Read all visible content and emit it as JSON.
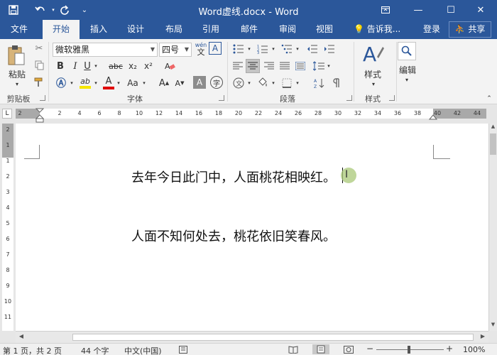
{
  "titlebar": {
    "title": "Word虚线.docx - Word",
    "save_icon": "save-icon",
    "undo_icon": "undo-icon",
    "redo_icon": "redo-icon",
    "customize_icon": "customize-quick-access-icon",
    "ribbon_options_icon": "ribbon-display-options-icon",
    "minimize": "—",
    "maximize": "☐",
    "close": "✕",
    "bg": "#2b579a"
  },
  "tabs": [
    {
      "label": "文件"
    },
    {
      "label": "开始",
      "active": true
    },
    {
      "label": "插入"
    },
    {
      "label": "设计"
    },
    {
      "label": "布局"
    },
    {
      "label": "引用"
    },
    {
      "label": "邮件"
    },
    {
      "label": "审阅"
    },
    {
      "label": "视图"
    }
  ],
  "tellme": "告诉我...",
  "login": "登录",
  "share": "共享",
  "ribbon": {
    "clipboard": {
      "paste_label": "粘贴",
      "group_label": "剪贴板"
    },
    "font": {
      "font_name": "微软雅黑",
      "font_size": "四号",
      "wen_glyph": "wén",
      "wen_char": "文",
      "boxed_a": "A",
      "bold": "B",
      "italic": "I",
      "underline": "U",
      "strike": "abc",
      "subscript": "x₂",
      "superscript": "x²",
      "highlight": "ab",
      "font_color": "A",
      "change_case": "Aa",
      "grow": "A",
      "shrink": "A",
      "shading_char": "A",
      "enclose_char": "字",
      "group_label": "字体",
      "highlight_color": "#f5e600",
      "font_color_value": "#e00000"
    },
    "paragraph": {
      "group_label": "段落"
    },
    "styles": {
      "label": "样式",
      "group_label": "样式"
    },
    "editing": {
      "label": "编辑"
    }
  },
  "ruler": {
    "corner": "L",
    "numbers": [
      "2",
      "2",
      "4",
      "6",
      "8",
      "10",
      "12",
      "14",
      "16",
      "18",
      "20",
      "22",
      "24",
      "26",
      "28",
      "30",
      "32",
      "34",
      "36",
      "38",
      "40",
      "42",
      "44"
    ],
    "vnumbers": [
      "2",
      "1",
      "1",
      "2",
      "3",
      "4",
      "5",
      "6",
      "7",
      "8",
      "9",
      "10",
      "11"
    ]
  },
  "document": {
    "line1": "去年今日此门中，人面桃花相映红。",
    "line2": "人面不知何处去，桃花依旧笑春风。"
  },
  "statusbar": {
    "page": "第 1 页，共 2 页",
    "words": "44 个字",
    "language": "中文(中国)",
    "zoom_minus": "−",
    "zoom_plus": "+",
    "zoom": "100%"
  }
}
